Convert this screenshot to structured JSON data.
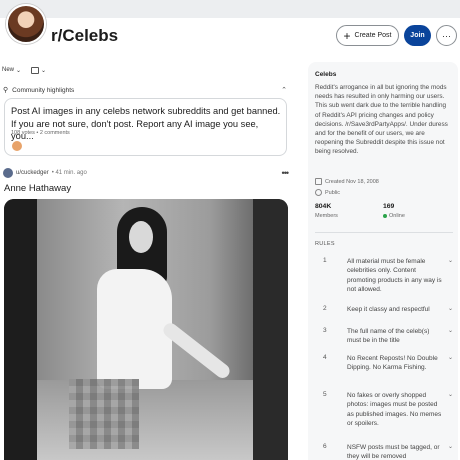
{
  "header": {
    "subreddit": "r/Celebs",
    "create_post_label": "Create Post",
    "join_label": "Join",
    "more_label": "···"
  },
  "sortbar": {
    "sort_value": "New",
    "sort_chevron": "⌄",
    "view_chevron": "⌄"
  },
  "highlights": {
    "label": "Community highlights",
    "collapse_icon": "⌃",
    "card": {
      "title": "Post AI images in any celebs network subreddits and get banned. If you are not sure, don't post. Report any AI image you see, you...",
      "meta": "108 votes • 2 comments"
    }
  },
  "post": {
    "author": "u/cuckedger",
    "time": "• 41 min. ago",
    "more": "•••",
    "title": "Anne Hathaway"
  },
  "sidebar": {
    "title": "Celebs",
    "description": "Reddit's arrogance in all but ignoring the mods needs has resulted in only harming our users. This sub went dark due to the terrible handling of Reddit's API pricing changes and policy decisions. /r/Save3rdPartyApps/. Under duress and for the benefit of our users, we are reopening the Subreddit despite this issue not being resolved.",
    "created": "Created Nov 18, 2008",
    "visibility": "Public",
    "members_count": "804K",
    "members_label": "Members",
    "online_count": "169",
    "online_label": "Online",
    "rules_header": "RULES",
    "rules": [
      {
        "num": "1",
        "text": "All material must be female celebrities only. Content promoting products in any way is not allowed."
      },
      {
        "num": "2",
        "text": "Keep it classy and respectful"
      },
      {
        "num": "3",
        "text": "The full name of the celeb(s) must be in the title"
      },
      {
        "num": "4",
        "text": "No Recent Reposts! No Double Dipping. No Karma Fishing."
      },
      {
        "num": "5",
        "text": "No fakes or overly shopped photos: images must be posted as published images. No memes or spoilers."
      },
      {
        "num": "6",
        "text": "NSFW posts must be tagged, or they will be removed"
      }
    ],
    "rule_chevron": "⌄"
  }
}
